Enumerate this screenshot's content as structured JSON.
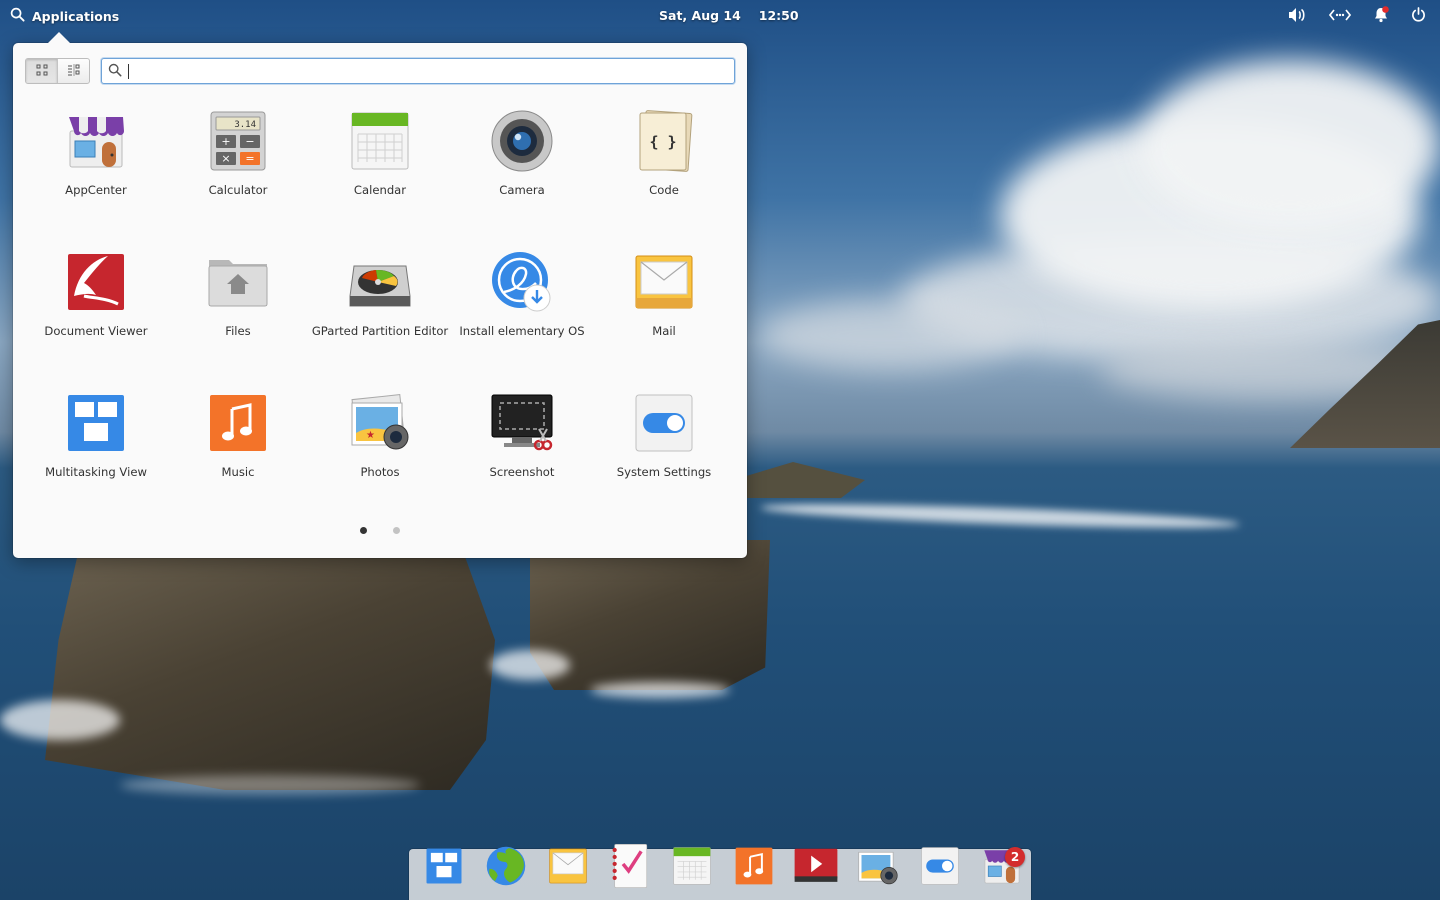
{
  "top_panel": {
    "applications_label": "Applications",
    "date": "Sat, Aug 14",
    "time": "12:50",
    "indicators": [
      "volume-icon",
      "network-icon",
      "notifications-icon",
      "power-icon"
    ],
    "notification_dot_color": "#e22b2b"
  },
  "launcher": {
    "view_modes": [
      "grid",
      "category"
    ],
    "active_view": "grid",
    "search": {
      "value": "",
      "placeholder": ""
    },
    "apps": [
      {
        "label": "AppCenter",
        "icon": "appcenter-icon"
      },
      {
        "label": "Calculator",
        "icon": "calculator-icon"
      },
      {
        "label": "Calendar",
        "icon": "calendar-icon"
      },
      {
        "label": "Camera",
        "icon": "camera-icon"
      },
      {
        "label": "Code",
        "icon": "code-icon"
      },
      {
        "label": "Document Viewer",
        "icon": "document-viewer-icon"
      },
      {
        "label": "Files",
        "icon": "files-icon"
      },
      {
        "label": "GParted Partition Editor",
        "icon": "gparted-icon"
      },
      {
        "label": "Install elementary OS",
        "icon": "installer-icon"
      },
      {
        "label": "Mail",
        "icon": "mail-icon"
      },
      {
        "label": "Multitasking View",
        "icon": "multitasking-icon"
      },
      {
        "label": "Music",
        "icon": "music-icon"
      },
      {
        "label": "Photos",
        "icon": "photos-icon"
      },
      {
        "label": "Screenshot",
        "icon": "screenshot-icon"
      },
      {
        "label": "System Settings",
        "icon": "system-settings-icon"
      }
    ],
    "calculator_display": "3.14",
    "pages": {
      "current": 1,
      "total": 2
    }
  },
  "dock": {
    "items": [
      {
        "icon": "multitasking-icon"
      },
      {
        "icon": "web-browser-icon"
      },
      {
        "icon": "mail-icon"
      },
      {
        "icon": "tasks-icon"
      },
      {
        "icon": "calendar-icon"
      },
      {
        "icon": "music-icon"
      },
      {
        "icon": "videos-icon"
      },
      {
        "icon": "photos-icon"
      },
      {
        "icon": "system-settings-icon"
      },
      {
        "icon": "appcenter-icon",
        "badge": "2"
      }
    ]
  },
  "colors": {
    "accent": "#3689e6",
    "badge": "#d32d2d",
    "launcher_bg": "#fafafa"
  }
}
